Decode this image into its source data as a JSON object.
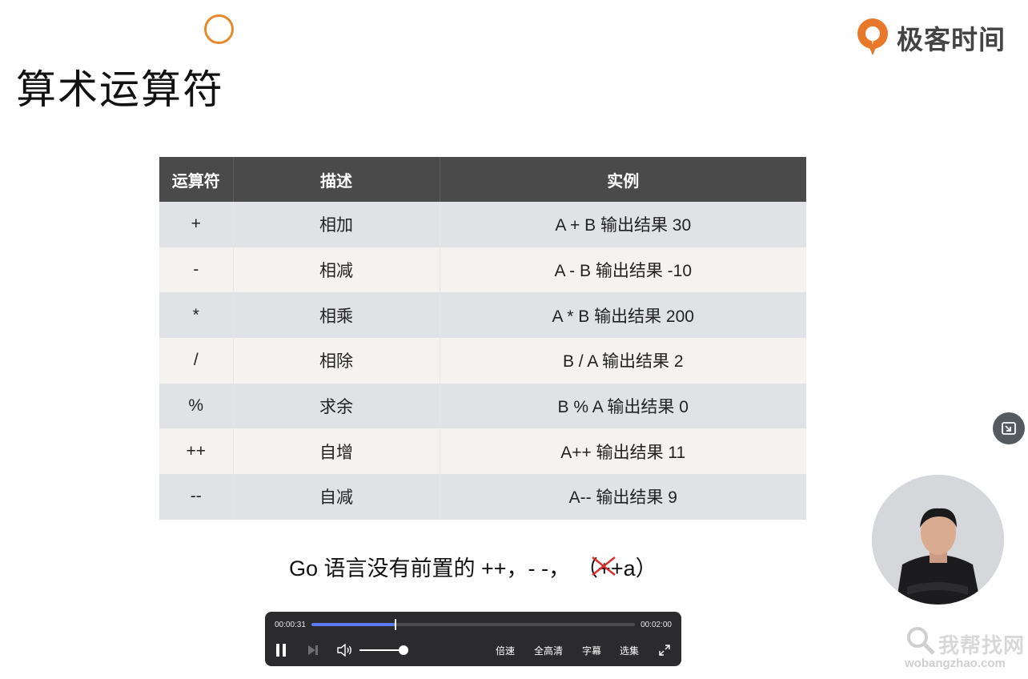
{
  "slide": {
    "title": "算术运算符",
    "brand": "极客时间"
  },
  "table": {
    "headers": [
      "运算符",
      "描述",
      "实例"
    ],
    "rows": [
      [
        "+",
        "相加",
        "A + B 输出结果 30"
      ],
      [
        "-",
        "相减",
        "A - B 输出结果 -10"
      ],
      [
        "*",
        "相乘",
        "A * B 输出结果 200"
      ],
      [
        "/",
        "相除",
        "B / A 输出结果 2"
      ],
      [
        "%",
        "求余",
        "B % A 输出结果 0"
      ],
      [
        "++",
        "自增",
        "A++ 输出结果 11"
      ],
      [
        "--",
        "自减",
        "A-- 输出结果 9"
      ]
    ]
  },
  "note": {
    "text": "Go 语言没有前置的 ++，- -，",
    "struck_open": "（",
    "struck_text": "++a",
    "struck_close": "）"
  },
  "player": {
    "current_time": "00:00:31",
    "duration": "00:02:00",
    "progress_fraction": 0.26,
    "volume_fraction": 0.95,
    "speed_label": "倍速",
    "quality_label": "全高清",
    "subtitle_label": "字幕",
    "episodes_label": "选集",
    "accent_color": "#5b7cf2"
  },
  "watermark": {
    "main": "我帮找网",
    "sub": "wobangzhao.com"
  },
  "colors": {
    "brand_orange": "#e8782a",
    "header_bg": "#4a4a4a",
    "row_odd": "#e1e2e6",
    "row_even": "#f4f3ef"
  }
}
